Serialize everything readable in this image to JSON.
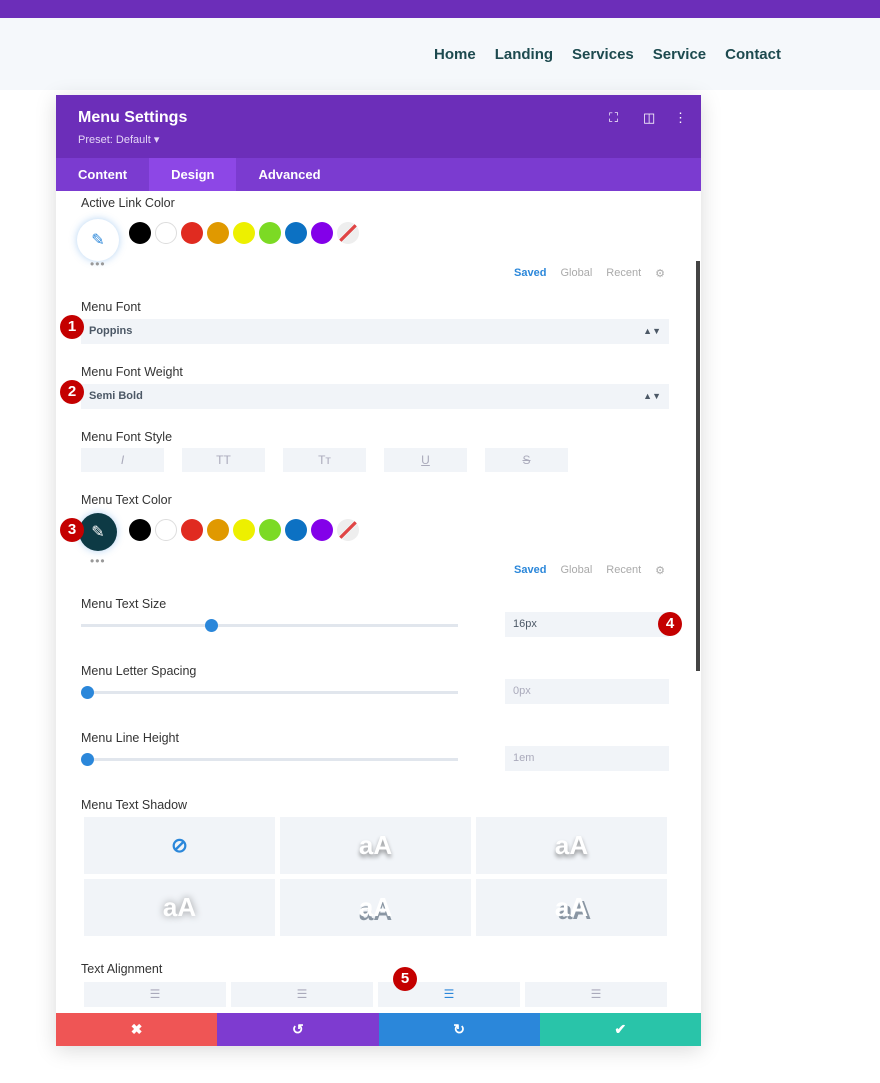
{
  "nav": [
    "Home",
    "Landing",
    "Services",
    "Service",
    "Contact"
  ],
  "panel": {
    "title": "Menu Settings",
    "preset": "Preset: Default ▾",
    "tabs": [
      "Content",
      "Design",
      "Advanced"
    ]
  },
  "swatches": [
    "#000000",
    "#ffffff",
    "#e02b20",
    "#e09900",
    "#edf000",
    "#7cda24",
    "#0c71c3",
    "#8300e9",
    "none"
  ],
  "palette_tabs": [
    "Saved",
    "Global",
    "Recent"
  ],
  "active_link_color": {
    "label": "Active Link Color"
  },
  "menu_font": {
    "label": "Menu Font",
    "value": "Poppins"
  },
  "menu_font_weight": {
    "label": "Menu Font Weight",
    "value": "Semi Bold"
  },
  "menu_font_style": {
    "label": "Menu Font Style",
    "options": [
      "I",
      "TT",
      "Tт",
      "U",
      "S"
    ]
  },
  "menu_text_color": {
    "label": "Menu Text Color",
    "value": "#0d3a45"
  },
  "menu_text_size": {
    "label": "Menu Text Size",
    "value": "16px",
    "slider_fraction": 0.34
  },
  "menu_letter_spacing": {
    "label": "Menu Letter Spacing",
    "value": "0px",
    "slider_fraction": 0
  },
  "menu_line_height": {
    "label": "Menu Line Height",
    "value": "1em",
    "slider_fraction": 0
  },
  "menu_text_shadow": {
    "label": "Menu Text Shadow",
    "preview": "aA",
    "selected": "none"
  },
  "text_alignment": {
    "label": "Text Alignment",
    "selected": "justify"
  },
  "badges": [
    "1",
    "2",
    "3",
    "4",
    "5"
  ],
  "footer": {
    "cancel": "✖",
    "undo": "↺",
    "redo": "↻",
    "save": "✔"
  },
  "colors": {
    "header": "#6c2eb9",
    "cancel": "#ef5555",
    "undo": "#7e3bd0",
    "redo": "#2b87da",
    "save": "#29c4a9"
  }
}
